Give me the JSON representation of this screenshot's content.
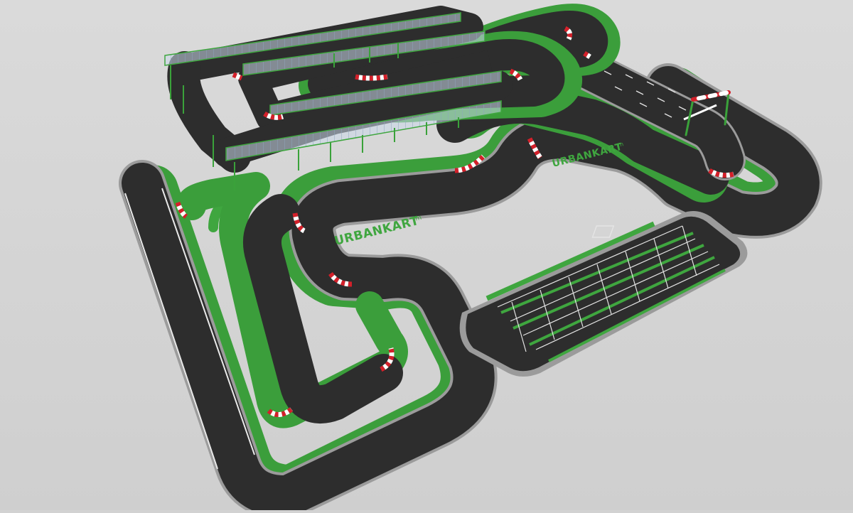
{
  "scene": {
    "description_free": true,
    "colors": {
      "background": "#d2d2d2",
      "asphalt": "#2d2d2d",
      "border_green": "#3fa63f",
      "border_green_dark": "#2e7d2e",
      "curb_red": "#d4202a",
      "curb_white": "#ffffff",
      "edge_line": "#e8e8e8",
      "glass": "#b7cbe0",
      "post_green": "#3aa23a"
    }
  },
  "logos": [
    {
      "text": "URBANKART",
      "suffix": "m"
    },
    {
      "text": "URBANKART",
      "suffix": "m"
    }
  ]
}
